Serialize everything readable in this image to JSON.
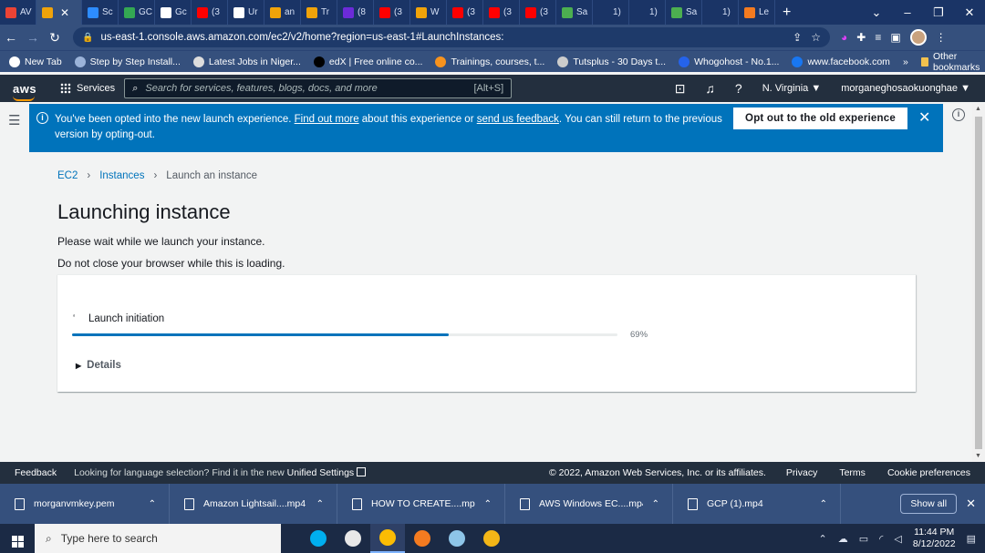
{
  "browser": {
    "tabs": [
      {
        "label": "AV",
        "color": "#ea4335"
      },
      {
        "label": "",
        "color": "#f0a30a",
        "active": true
      },
      {
        "label": "Sc",
        "color": "#2d8cff"
      },
      {
        "label": "GC",
        "color": "#34a853"
      },
      {
        "label": "Gc",
        "color": "#ffffff"
      },
      {
        "label": "(3",
        "color": "#ff0000"
      },
      {
        "label": "Ur",
        "color": "#ffffff"
      },
      {
        "label": "an",
        "color": "#f0a30a"
      },
      {
        "label": "Tr",
        "color": "#f0a30a"
      },
      {
        "label": "(8",
        "color": "#6c2bd9"
      },
      {
        "label": "(3",
        "color": "#ff0000"
      },
      {
        "label": "W",
        "color": "#f0a30a"
      },
      {
        "label": "(3",
        "color": "#ff0000"
      },
      {
        "label": "(3",
        "color": "#ff0000"
      },
      {
        "label": "(3",
        "color": "#ff0000"
      },
      {
        "label": "Sa",
        "color": "#4caf50"
      },
      {
        "label": "1)",
        "color": "#1a3466"
      },
      {
        "label": "1)",
        "color": "#1a3466"
      },
      {
        "label": "Sa",
        "color": "#4caf50"
      },
      {
        "label": "1)",
        "color": "#1a3466"
      },
      {
        "label": "Le",
        "color": "#f47b20"
      }
    ],
    "tab_close": "✕",
    "new_tab": "+",
    "url": "us-east-1.console.aws.amazon.com/ec2/v2/home?region=us-east-1#LaunchInstances:",
    "bookmarks": [
      {
        "label": "New Tab",
        "color": "#ffffff"
      },
      {
        "label": "Step by Step Install...",
        "color": "#9bb3d9"
      },
      {
        "label": "Latest Jobs in Niger...",
        "color": "#dddddd"
      },
      {
        "label": "edX | Free online co...",
        "color": "#000000"
      },
      {
        "label": "Trainings, courses, t...",
        "color": "#f7931e"
      },
      {
        "label": "Tutsplus - 30 Days t...",
        "color": "#cccccc"
      },
      {
        "label": "Whogohost - No.1...",
        "color": "#2563eb"
      },
      {
        "label": "www.facebook.com",
        "color": "#1877f2"
      }
    ],
    "bookmarks_more": "»",
    "other_bookmarks": "Other bookmarks"
  },
  "aws": {
    "logo": "aws",
    "services": "Services",
    "search_placeholder": "Search for services, features, blogs, docs, and more",
    "search_shortcut": "[Alt+S]",
    "region": "N. Virginia ▼",
    "account": "morganeghosaokuonghae ▼",
    "brand_color": "#232f3e",
    "accent_color": "#ff9900"
  },
  "flash": {
    "text_before": "You've been opted into the new launch experience. ",
    "link1": "Find out more",
    "text_mid": " about this experience or ",
    "link2": "send us feedback",
    "text_after": ". You can still return to the previous version by opting-out.",
    "button": "Opt out to the old experience",
    "color": "#0073bb"
  },
  "breadcrumb": {
    "items": [
      "EC2",
      "Instances",
      "Launch an instance"
    ],
    "sep": ">"
  },
  "page": {
    "title": "Launching instance",
    "msg1": "Please wait while we launch your instance.",
    "msg2": "Do not close your browser while this is loading."
  },
  "launch": {
    "step": "Launch initiation",
    "progress_percent": 69,
    "progress_text": "69%",
    "details": "Details"
  },
  "footer": {
    "feedback": "Feedback",
    "lang_text": "Looking for language selection? Find it in the new ",
    "lang_link": "Unified Settings",
    "copyright": "© 2022, Amazon Web Services, Inc. or its affiliates.",
    "privacy": "Privacy",
    "terms": "Terms",
    "cookies": "Cookie preferences"
  },
  "downloads": {
    "items": [
      "morganvmkey.pem",
      "Amazon Lightsail....mp4",
      "HOW TO CREATE....mp4",
      "AWS Windows EC....mp4",
      "GCP (1).mp4"
    ],
    "show_all": "Show all"
  },
  "taskbar": {
    "search_placeholder": "Type here to search",
    "apps": [
      {
        "name": "skype",
        "color": "#00aff0"
      },
      {
        "name": "chrome-profile",
        "color": "#e8e8e8"
      },
      {
        "name": "chrome",
        "color": "#fbbc04",
        "active": true
      },
      {
        "name": "vlc",
        "color": "#f47b20"
      },
      {
        "name": "notes",
        "color": "#8ec5e8"
      },
      {
        "name": "lock-app",
        "color": "#f3b617"
      }
    ],
    "time": "11:44 PM",
    "date": "8/12/2022"
  }
}
